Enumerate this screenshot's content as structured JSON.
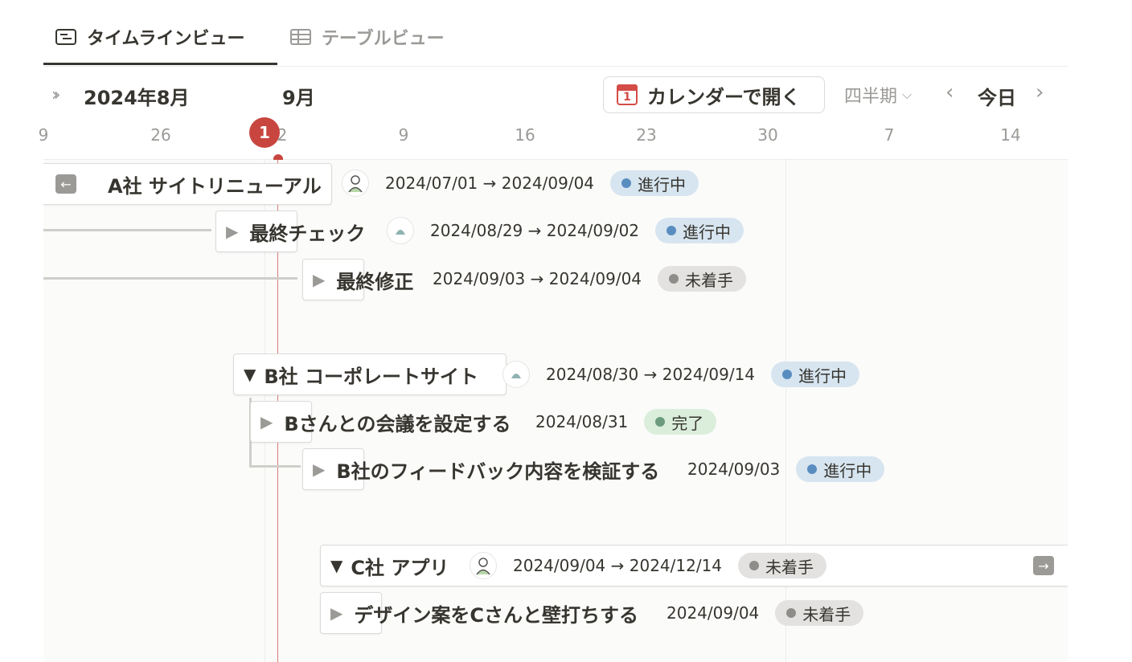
{
  "tabs": {
    "timeline": "タイムラインビュー",
    "table": "テーブルビュー"
  },
  "header": {
    "month_left": "2024年8月",
    "month_right": "9月",
    "open_calendar": "カレンダーで開く",
    "calendar_icon_day": "1",
    "period": "四半期",
    "today": "今日",
    "today_marker": "1",
    "days": [
      "9",
      "26",
      "2",
      "9",
      "16",
      "23",
      "30",
      "7",
      "14"
    ]
  },
  "tasks": [
    {
      "title": "A社 サイトリニューアル",
      "dates": "2024/07/01 → 2024/09/04",
      "status": "進行中"
    },
    {
      "title": "最終チェック",
      "dates": "2024/08/29 → 2024/09/02",
      "status": "進行中"
    },
    {
      "title": "最終修正",
      "dates": "2024/09/03 → 2024/09/04",
      "status": "未着手"
    },
    {
      "title": "B社 コーポレートサイト",
      "dates": "2024/08/30 → 2024/09/14",
      "status": "進行中"
    },
    {
      "title": "Bさんとの会議を設定する",
      "dates": "2024/08/31",
      "status": "完了"
    },
    {
      "title": "B社のフィードバック内容を検証する",
      "dates": "2024/09/03",
      "status": "進行中"
    },
    {
      "title": "C社 アプリ",
      "dates": "2024/09/04 → 2024/12/14",
      "status": "未着手"
    },
    {
      "title": "デザイン案をCさんと壁打ちする",
      "dates": "2024/09/04",
      "status": "未着手"
    }
  ],
  "colors": {
    "today_red": "#c8463f",
    "in_progress_bg": "#d7e5f0",
    "not_started_bg": "#e3e2e0",
    "done_bg": "#dbeddb"
  },
  "icons": [
    "table-list-icon",
    "grid-table-icon",
    "double-chevron-icon",
    "calendar-icon",
    "chevron-down-icon",
    "chevron-left-icon",
    "chevron-right-icon",
    "back-arrow-icon",
    "forward-arrow-icon",
    "avatar-icon"
  ]
}
